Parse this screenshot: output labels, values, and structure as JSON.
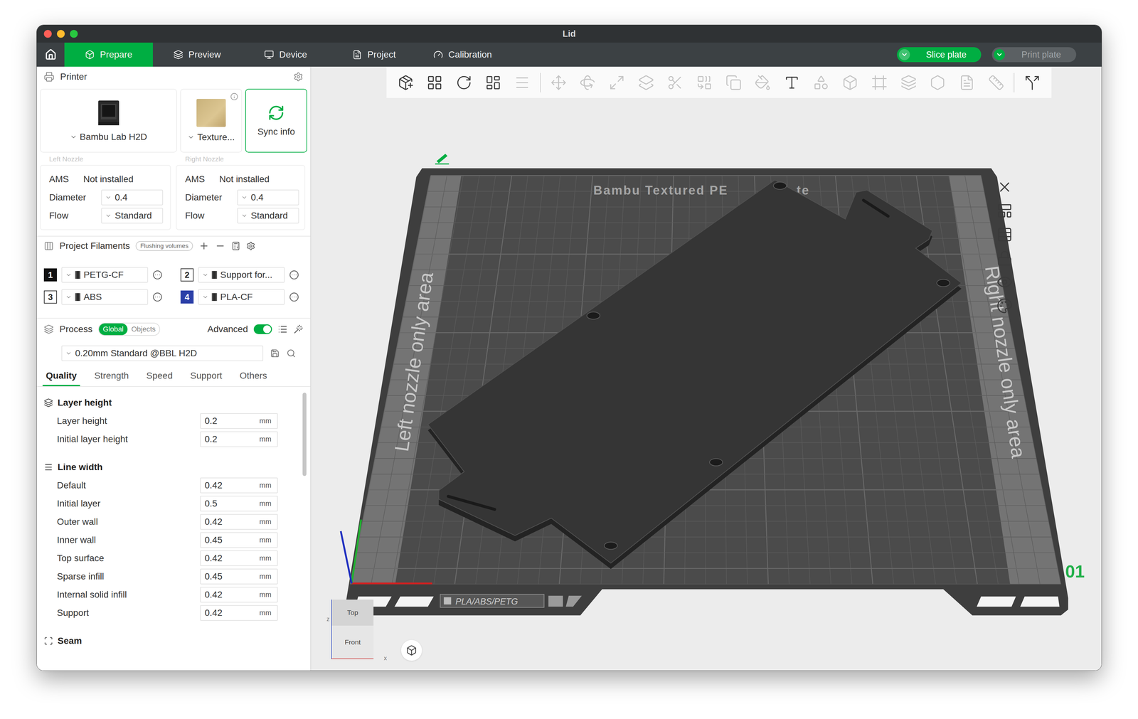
{
  "window": {
    "title": "Lid"
  },
  "nav": {
    "tabs": [
      {
        "label": "Prepare",
        "selected": true
      },
      {
        "label": "Preview",
        "selected": false
      },
      {
        "label": "Device",
        "selected": false
      },
      {
        "label": "Project",
        "selected": false
      },
      {
        "label": "Calibration",
        "selected": false
      }
    ],
    "slice_button": {
      "label": "Slice plate",
      "disabled": false
    },
    "print_button": {
      "label": "Print plate",
      "disabled": true
    }
  },
  "printer_panel": {
    "title": "Printer",
    "printer": "Bambu Lab H2D",
    "plate": "Texture...",
    "sync": "Sync info",
    "nozzles": [
      {
        "label": "Left Nozzle",
        "ams_label": "AMS",
        "ams_value": "Not installed",
        "diameter_label": "Diameter",
        "diameter": "0.4",
        "flow_label": "Flow",
        "flow": "Standard"
      },
      {
        "label": "Right Nozzle",
        "ams_label": "AMS",
        "ams_value": "Not installed",
        "diameter_label": "Diameter",
        "diameter": "0.4",
        "flow_label": "Flow",
        "flow": "Standard"
      }
    ]
  },
  "filaments": {
    "title": "Project Filaments",
    "flushing": "Flushing volumes",
    "items": [
      {
        "number": "1",
        "name": "PETG-CF",
        "color": "#111111"
      },
      {
        "number": "2",
        "name": "Support for...",
        "color": "#ffffff"
      },
      {
        "number": "3",
        "name": "ABS",
        "color": "#ffffff"
      },
      {
        "number": "4",
        "name": "PLA-CF",
        "color": "#2b3fa8"
      }
    ]
  },
  "process": {
    "title": "Process",
    "scope": [
      {
        "label": "Global",
        "selected": true
      },
      {
        "label": "Objects",
        "selected": false
      }
    ],
    "advanced": {
      "label": "Advanced",
      "on": true
    },
    "preset": "0.20mm Standard @BBL H2D",
    "tabs": [
      {
        "label": "Quality",
        "selected": true
      },
      {
        "label": "Strength",
        "selected": false
      },
      {
        "label": "Speed",
        "selected": false
      },
      {
        "label": "Support",
        "selected": false
      },
      {
        "label": "Others",
        "selected": false
      }
    ],
    "groups": [
      {
        "title": "Layer height",
        "rows": [
          {
            "label": "Layer height",
            "value": "0.2",
            "unit": "mm"
          },
          {
            "label": "Initial layer height",
            "value": "0.2",
            "unit": "mm"
          }
        ]
      },
      {
        "title": "Line width",
        "rows": [
          {
            "label": "Default",
            "value": "0.42",
            "unit": "mm"
          },
          {
            "label": "Initial layer",
            "value": "0.5",
            "unit": "mm"
          },
          {
            "label": "Outer wall",
            "value": "0.42",
            "unit": "mm"
          },
          {
            "label": "Inner wall",
            "value": "0.45",
            "unit": "mm"
          },
          {
            "label": "Top surface",
            "value": "0.42",
            "unit": "mm"
          },
          {
            "label": "Sparse infill",
            "value": "0.45",
            "unit": "mm"
          },
          {
            "label": "Internal solid infill",
            "value": "0.42",
            "unit": "mm"
          },
          {
            "label": "Support",
            "value": "0.42",
            "unit": "mm"
          }
        ]
      },
      {
        "title": "Seam",
        "rows": []
      }
    ],
    "scrollbar": {
      "level": 0.12
    }
  },
  "toolbar": {
    "tools": [
      {
        "disabled": false
      },
      {
        "disabled": false
      },
      {
        "disabled": false
      },
      {
        "disabled": false
      },
      {
        "disabled": true
      },
      {
        "disabled": true
      },
      {
        "disabled": true
      },
      {
        "disabled": true
      },
      {
        "disabled": true
      },
      {
        "disabled": true
      },
      {
        "disabled": true
      },
      {
        "disabled": true
      },
      {
        "disabled": true
      },
      {
        "disabled": false
      },
      {
        "disabled": true
      },
      {
        "disabled": true
      },
      {
        "disabled": true
      },
      {
        "disabled": true
      },
      {
        "disabled": true
      },
      {
        "disabled": true
      },
      {
        "disabled": true
      },
      {
        "disabled": false
      }
    ]
  },
  "plate": {
    "name_parts": [
      "Bambu Textured PE",
      "te"
    ],
    "left_area": "Left nozzle only area",
    "right_area": "Right nozzle only area",
    "material_label": "PLA/ABS/PETG",
    "number": "01"
  },
  "view_cube": {
    "top": "Top",
    "front": "Front",
    "z_label": "z",
    "x_label": "x"
  }
}
